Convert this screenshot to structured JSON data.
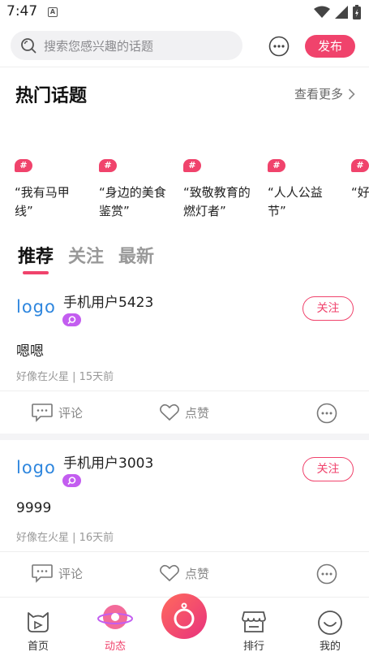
{
  "status_bar": {
    "time": "7:47",
    "notification_letter": "A"
  },
  "header": {
    "search_placeholder": "搜索您感兴趣的话题",
    "publish_label": "发布"
  },
  "hot_topics": {
    "title": "热门话题",
    "view_more": "查看更多",
    "items": [
      {
        "badge": "#",
        "text": "“我有马甲线”"
      },
      {
        "badge": "#",
        "text": "“身边的美食鉴赏”"
      },
      {
        "badge": "#",
        "text": "“致敬教育的燃灯者”"
      },
      {
        "badge": "#",
        "text": "“人人公益节”"
      },
      {
        "badge": "#",
        "text": "“好图鉴"
      }
    ]
  },
  "feed_tabs": [
    "推荐",
    "关注",
    "最新"
  ],
  "posts": [
    {
      "logo": "logo",
      "user": "手机用户5423",
      "follow": "关注",
      "content": "嗯嗯",
      "meta": "好像在火星 | 15天前",
      "comment": "评论",
      "like": "点赞"
    },
    {
      "logo": "logo",
      "user": "手机用户3003",
      "follow": "关注",
      "content": "9999",
      "meta": "好像在火星 | 16天前",
      "comment": "评论",
      "like": "点赞"
    }
  ],
  "bottom_nav": [
    {
      "label": "首页"
    },
    {
      "label": "动态"
    },
    {
      "label": ""
    },
    {
      "label": "排行"
    },
    {
      "label": "我的"
    }
  ],
  "colors": {
    "accent": "#f0436c",
    "logo_blue": "#2e86de",
    "tag_purple": "#c35df0"
  }
}
